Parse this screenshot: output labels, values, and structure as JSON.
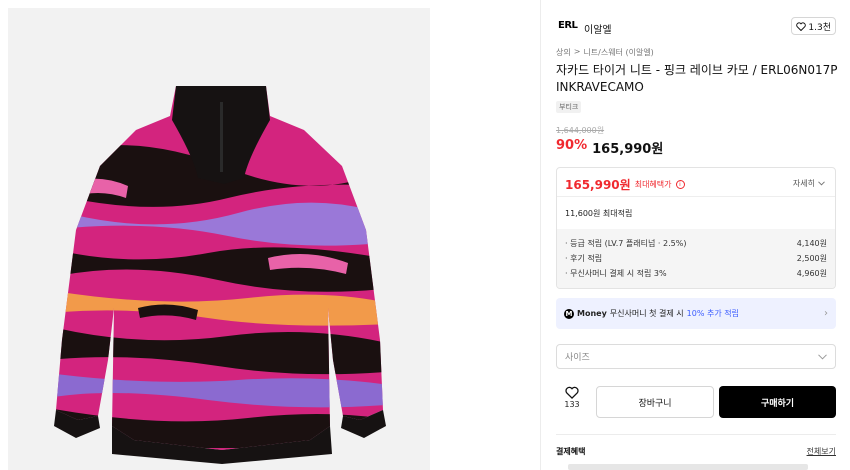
{
  "brand": {
    "logo_text": "ERL",
    "name": "이알엘"
  },
  "like": {
    "count": "1.3천"
  },
  "breadcrumb": {
    "level1": "상의",
    "separator": ">",
    "level2": "니트/스웨터 (이알엘)"
  },
  "product": {
    "title": "자카드 타이거 니트 - 핑크 레이브 카모 / ERL06N017PINKRAVECAMO",
    "tag": "부티크",
    "original_price": "1,644,000원",
    "discount": "90%",
    "sale_price": "165,990원"
  },
  "benefit": {
    "price": "165,990원",
    "label": "최대혜택가",
    "info_icon": "i",
    "detail_link": "자세히",
    "max_point": "11,600원 최대적립",
    "points": [
      {
        "label": "· 등급 적립 (LV.7 플래티넘 · 2.5%)",
        "value": "4,140원"
      },
      {
        "label": "· 후기 적립",
        "value": "2,500원"
      },
      {
        "label": "· 무신사머니 결제 시 적립 3%",
        "value": "4,960원"
      }
    ]
  },
  "money_banner": {
    "icon_letter": "M",
    "brand": "Money",
    "text": "무신사머니 첫 결제 시",
    "accent": "10% 추가 적립",
    "arrow": "›"
  },
  "size_select": {
    "placeholder": "사이즈"
  },
  "actions": {
    "wish_count": "133",
    "cart_label": "장바구니",
    "buy_label": "구매하기"
  },
  "payment": {
    "title": "결제혜택",
    "view_all": "전체보기"
  },
  "colors": {
    "accent_red": "#f0292f",
    "money_blue": "#3b5cff",
    "buy_black": "#000000",
    "banner_bg": "#eef1ff"
  },
  "icons": {
    "like": "heart-icon",
    "detail": "chevron-down-icon",
    "select": "chevron-down-icon",
    "wish": "heart-icon"
  }
}
